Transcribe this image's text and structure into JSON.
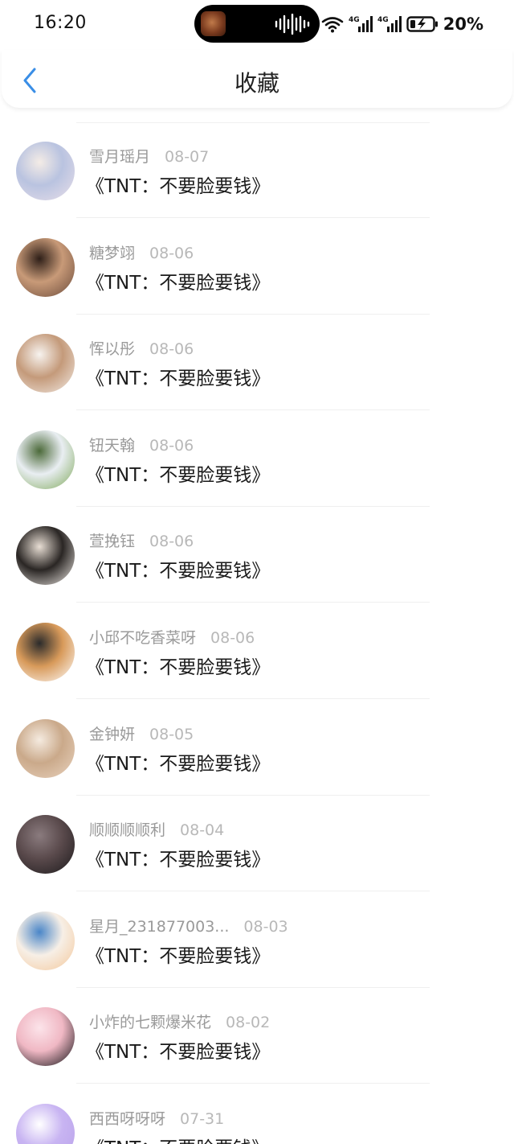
{
  "status_bar": {
    "time": "16:20",
    "battery": "20%",
    "icons": [
      "wifi-icon",
      "4g-signal-icon",
      "4g-signal-icon",
      "battery-charging-icon"
    ]
  },
  "header": {
    "title": "收藏",
    "back_icon": "chevron-left-icon"
  },
  "items": [
    {
      "name": "雪月瑶月",
      "date": "08-07",
      "content": "《TNT：不要脸要钱》",
      "avatar_colors": [
        "#e9dfe9",
        "#b9c3e0",
        "#f4ece6"
      ]
    },
    {
      "name": "糖梦翊",
      "date": "08-06",
      "content": "《TNT：不要脸要钱》",
      "avatar_colors": [
        "#6a4a3a",
        "#c89a78",
        "#2e1f18"
      ]
    },
    {
      "name": "恽以彤",
      "date": "08-06",
      "content": "《TNT：不要脸要钱》",
      "avatar_colors": [
        "#f3ece6",
        "#c49a7a",
        "#f7f3ef"
      ]
    },
    {
      "name": "钮天翰",
      "date": "08-06",
      "content": "《TNT：不要脸要钱》",
      "avatar_colors": [
        "#7fa85a",
        "#e9eef2",
        "#4c6a3a"
      ]
    },
    {
      "name": "萱挽钰",
      "date": "08-06",
      "content": "《TNT：不要脸要钱》",
      "avatar_colors": [
        "#f2ede8",
        "#2a2624",
        "#e8ded4"
      ]
    },
    {
      "name": "小邱不吃香菜呀",
      "date": "08-06",
      "content": "《TNT：不要脸要钱》",
      "avatar_colors": [
        "#ffffff",
        "#d89a5a",
        "#2b2b2b"
      ]
    },
    {
      "name": "金钟妍",
      "date": "08-05",
      "content": "《TNT：不要脸要钱》",
      "avatar_colors": [
        "#e9d3bf",
        "#caa98a",
        "#f5ebe0"
      ]
    },
    {
      "name": "顺顺顺顺利",
      "date": "08-04",
      "content": "《TNT：不要脸要钱》",
      "avatar_colors": [
        "#1c1a1c",
        "#5a4a4c",
        "#8a7b7e"
      ]
    },
    {
      "name": "星月_231877003...",
      "date": "08-03",
      "content": "《TNT：不要脸要钱》",
      "avatar_colors": [
        "#f3c79a",
        "#f7efe6",
        "#4a86c8"
      ]
    },
    {
      "name": "小炸的七颗爆米花",
      "date": "08-02",
      "content": "《TNT：不要脸要钱》",
      "avatar_colors": [
        "#0e0e12",
        "#f0b8c4",
        "#fce4ea"
      ]
    },
    {
      "name": "西西呀呀呀",
      "date": "07-31",
      "content": "《TNT：不要脸要钱》",
      "avatar_colors": [
        "#b9a2ea",
        "#c8b4f2",
        "#ffffff"
      ]
    }
  ]
}
